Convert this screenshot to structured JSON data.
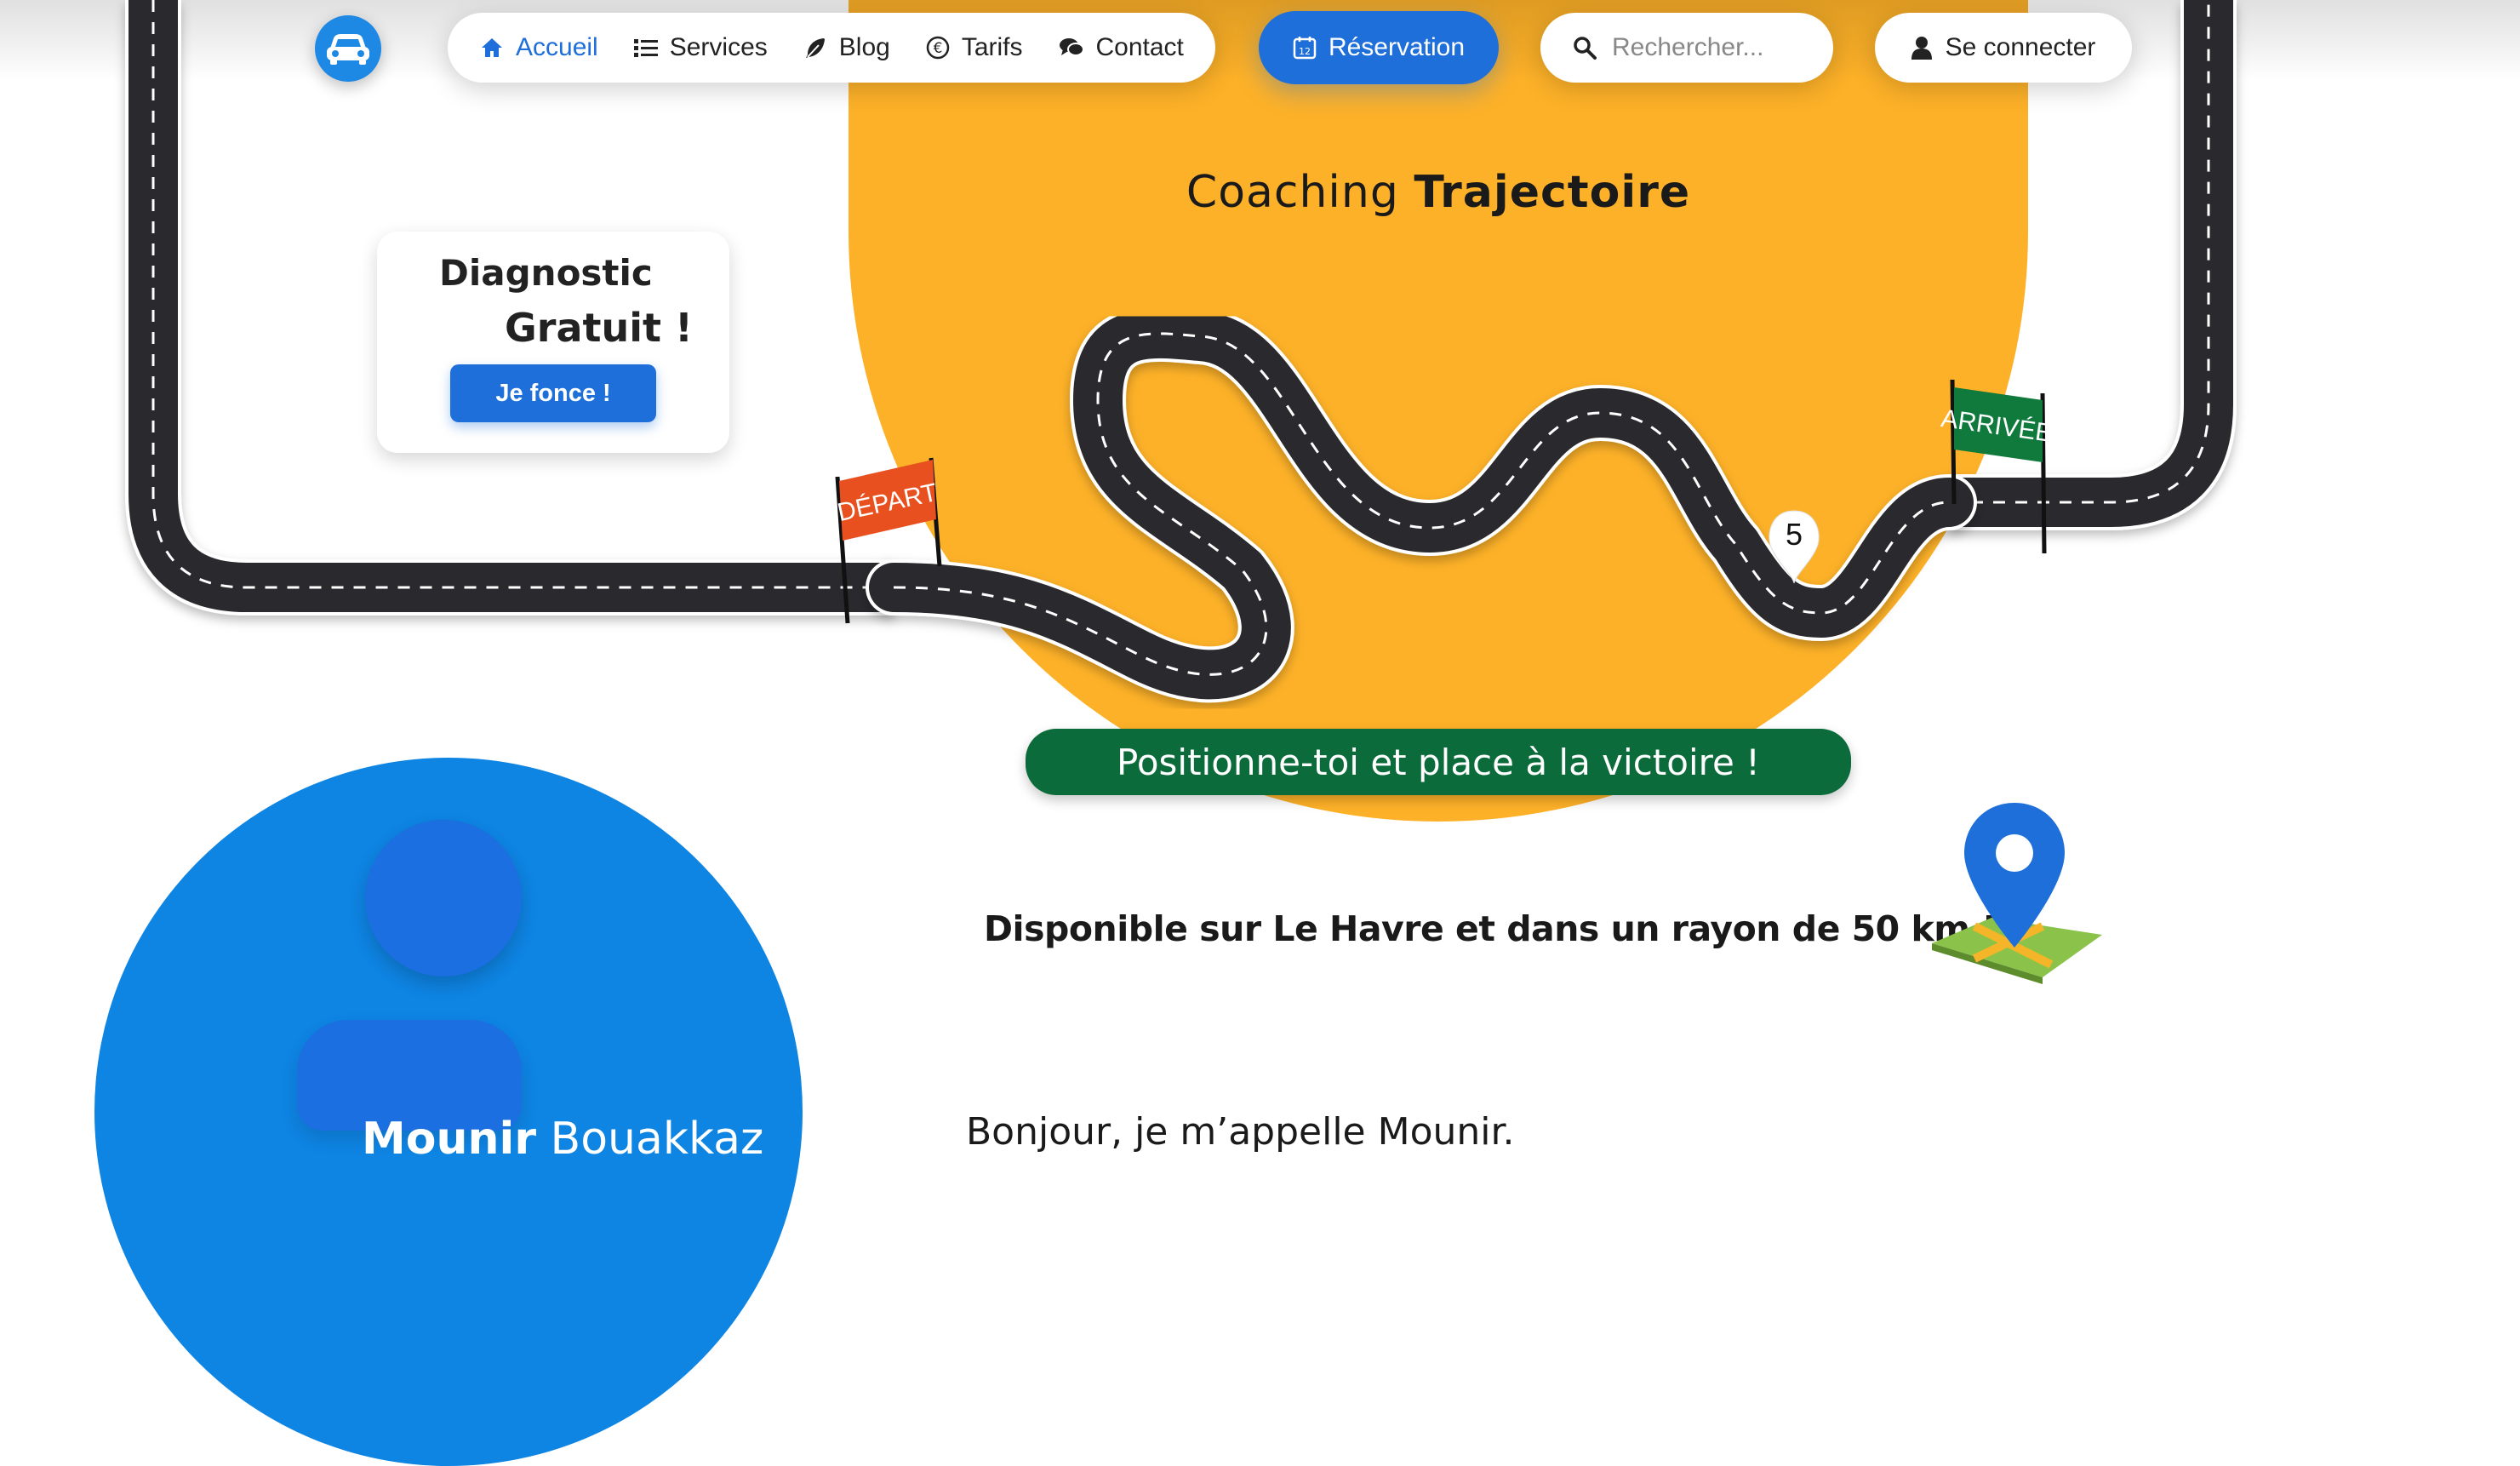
{
  "nav": {
    "items": [
      {
        "label": "Accueil",
        "icon": "home-icon",
        "active": true
      },
      {
        "label": "Services",
        "icon": "list-icon",
        "active": false
      },
      {
        "label": "Blog",
        "icon": "feather-icon",
        "active": false
      },
      {
        "label": "Tarifs",
        "icon": "euro-icon",
        "active": false
      },
      {
        "label": "Contact",
        "icon": "chat-icon",
        "active": false
      }
    ],
    "reservation_label": "Réservation",
    "reservation_icon_text": "12",
    "search_placeholder": "Rechercher...",
    "login_label": "Se connecter"
  },
  "hero": {
    "title_light": "Coaching ",
    "title_bold": "Trajectoire",
    "flag_start": "DÉPART",
    "flag_end": "ARRIVÉE",
    "pin_number": "5",
    "banner": "Positionne-toi et place à la victoire !"
  },
  "diagnostic_card": {
    "line1": "Diagnostic",
    "line2": "Gratuit !",
    "button_label": "Je fonce !"
  },
  "availability": "Disponible sur Le Havre et dans un rayon de 50 km !",
  "profile": {
    "first_name": "Mounir",
    "last_name": " Bouakkaz"
  },
  "greeting": "Bonjour, je m’appelle Mounir.",
  "colors": {
    "primary_blue": "#1e6fd9",
    "accent_yellow": "#fdb128",
    "banner_green": "#0b6b3a",
    "flag_start": "#e8511f",
    "flag_end": "#0f7a3c",
    "profile_blue": "#0e84e3"
  }
}
